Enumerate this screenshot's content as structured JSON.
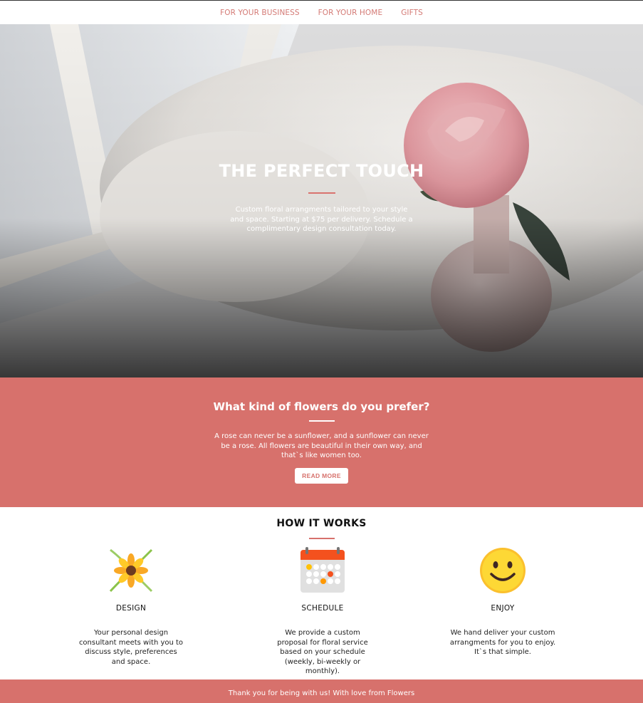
{
  "nav": {
    "items": [
      {
        "label": "FOR YOUR BUSINESS"
      },
      {
        "label": "FOR YOUR HOME"
      },
      {
        "label": "GIFTS"
      }
    ]
  },
  "hero": {
    "title": "THE PERFECT TOUCH",
    "description": "Custom floral arrangments tailored to your style and space. Starting at $75 per delivery. Schedule a complimentary design consultation today."
  },
  "prefer": {
    "title": "What kind of flowers do you prefer?",
    "text": "A rose can never be a sunflower, and a sunflower can never be a rose. All flowers are beautiful in their own way, and that`s like women too.",
    "button_label": "READ MORE"
  },
  "how_it_works": {
    "title": "HOW IT WORKS",
    "steps": [
      {
        "icon": "flower-icon",
        "title": "DESIGN",
        "text": "Your personal design consultant meets with you to discuss style, preferences and space."
      },
      {
        "icon": "calendar-icon",
        "title": "SCHEDULE",
        "text": "We provide a custom proposal for floral service based on your schedule (weekly, bi-weekly or monthly)."
      },
      {
        "icon": "smiley-icon",
        "title": "ENJOY",
        "text": "We hand deliver your custom arrangments for you to enjoy. It`s that simple."
      }
    ]
  },
  "footer": {
    "text": "Thank you for being with us! With love from Flowers"
  },
  "colors": {
    "accent": "#d7716c",
    "nav_link": "#d47a75"
  }
}
